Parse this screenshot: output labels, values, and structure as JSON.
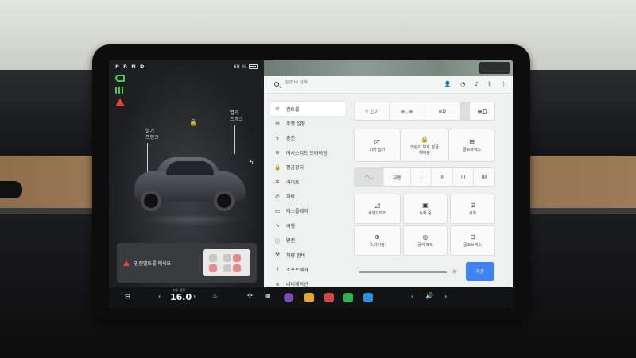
{
  "status": {
    "gear": "P R N D",
    "battery": "68 %"
  },
  "car_panel": {
    "frunk_label": "열기\n프렁크",
    "trunk_label": "열기\n트렁크",
    "alert_text": "안전벨트를 매세요"
  },
  "search": {
    "placeholder": "설정 내 검색"
  },
  "menu": [
    {
      "icon": "toggle-icon",
      "glyph": "⊙",
      "label": "컨트롤",
      "active": true
    },
    {
      "icon": "car-icon",
      "glyph": "⊟",
      "label": "주행 설정"
    },
    {
      "icon": "bolt-icon",
      "glyph": "ϟ",
      "label": "충전"
    },
    {
      "icon": "steering-icon",
      "glyph": "⊕",
      "label": "어시스티드 드라이빙"
    },
    {
      "icon": "lock-icon",
      "glyph": "🔒",
      "label": "잠금장치"
    },
    {
      "icon": "light-icon",
      "glyph": "✲",
      "label": "라이트"
    },
    {
      "icon": "phone-icon",
      "glyph": "✆",
      "label": "차박"
    },
    {
      "icon": "display-icon",
      "glyph": "▭",
      "label": "디스플레이"
    },
    {
      "icon": "trip-icon",
      "glyph": "∿",
      "label": "여행"
    },
    {
      "icon": "safety-icon",
      "glyph": "ⓘ",
      "label": "안전"
    },
    {
      "icon": "wrench-icon",
      "glyph": "⚒",
      "label": "차량 정비"
    },
    {
      "icon": "download-icon",
      "glyph": "⇩",
      "label": "소프트웨어"
    },
    {
      "icon": "wifi-icon",
      "glyph": "≋",
      "label": "내비게이션"
    }
  ],
  "controls": {
    "lights_row": [
      "끄기",
      "",
      "",
      "",
      ""
    ],
    "lights_auto": "자동",
    "doors_row": [
      "미러 접기",
      "어린이 보호 잠금\n해제됨",
      "글로브박스"
    ],
    "wipers_row": [
      "",
      "자동",
      "I",
      "II",
      "III",
      "IIII"
    ],
    "grid": [
      "사이드미러",
      "녹화 중",
      "세차",
      "스티어링",
      "공석 모드",
      "글로브박스"
    ],
    "auto_button": "자동"
  },
  "taskbar": {
    "temp_label": "수동 설정",
    "temperature": "16.0"
  },
  "colors": {
    "accent": "#3e83f0",
    "alert": "#e0473b",
    "telltale": "#3fcf4a"
  }
}
